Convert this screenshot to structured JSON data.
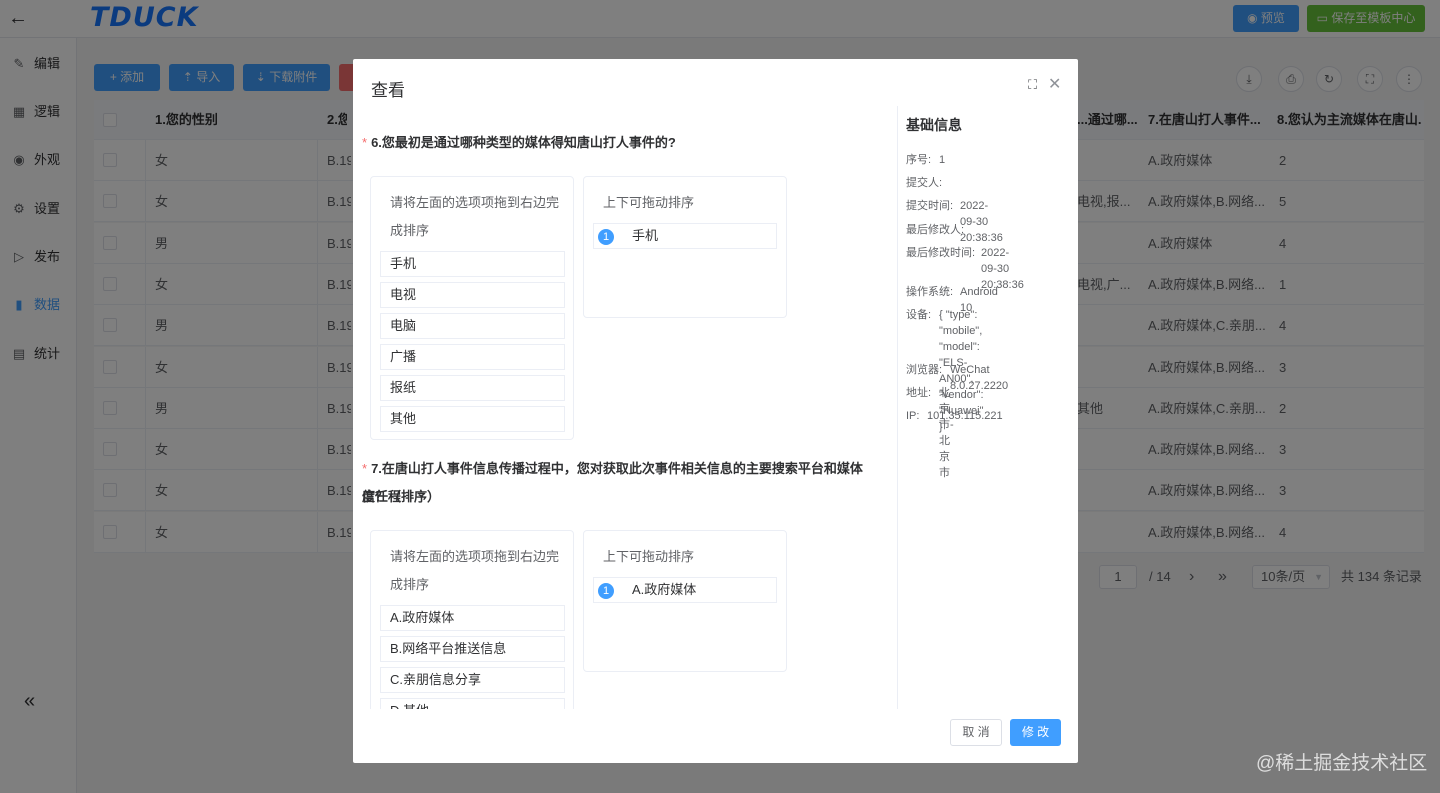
{
  "header": {
    "back_icon": "back-arrow-icon",
    "logo": "TDUCK",
    "preview_label": "预览",
    "save_template_label": "保存至模板中心"
  },
  "sidebar": {
    "items": [
      {
        "label": "编辑",
        "icon": "edit-icon"
      },
      {
        "label": "逻辑",
        "icon": "grid-icon"
      },
      {
        "label": "外观",
        "icon": "eye-icon"
      },
      {
        "label": "设置",
        "icon": "gear-icon"
      },
      {
        "label": "发布",
        "icon": "play-icon"
      },
      {
        "label": "数据",
        "icon": "chart-icon",
        "active": true
      },
      {
        "label": "统计",
        "icon": "stats-icon"
      }
    ],
    "collapse_icon": "double-chevron-left-icon"
  },
  "toolbar": {
    "add_label": "添加",
    "import_label": "导入",
    "download_label": "下载附件"
  },
  "table": {
    "headers": [
      "1.您的性别",
      "2.您...",
      "...通过哪...",
      "7.在唐山打人事件...",
      "8.您认为主流媒体在唐山..."
    ],
    "rows": [
      {
        "c1": "女",
        "c2": "B.19",
        "c3": "",
        "c4": "A.政府媒体",
        "c5": "2"
      },
      {
        "c1": "女",
        "c2": "B.19",
        "c3": "电视,报...",
        "c4": "A.政府媒体,B.网络...",
        "c5": "5"
      },
      {
        "c1": "男",
        "c2": "B.19",
        "c3": "",
        "c4": "A.政府媒体",
        "c5": "4"
      },
      {
        "c1": "女",
        "c2": "B.19",
        "c3": "电视,广...",
        "c4": "A.政府媒体,B.网络...",
        "c5": "1"
      },
      {
        "c1": "男",
        "c2": "B.19",
        "c3": "",
        "c4": "A.政府媒体,C.亲朋...",
        "c5": "4"
      },
      {
        "c1": "女",
        "c2": "B.19",
        "c3": "",
        "c4": "A.政府媒体,B.网络...",
        "c5": "3"
      },
      {
        "c1": "男",
        "c2": "B.19",
        "c3": "其他",
        "c4": "A.政府媒体,C.亲朋...",
        "c5": "2"
      },
      {
        "c1": "女",
        "c2": "B.19",
        "c3": "",
        "c4": "A.政府媒体,B.网络...",
        "c5": "3"
      },
      {
        "c1": "女",
        "c2": "B.19",
        "c3": "",
        "c4": "A.政府媒体,B.网络...",
        "c5": "3"
      },
      {
        "c1": "女",
        "c2": "B.19",
        "c3": "",
        "c4": "A.政府媒体,B.网络...",
        "c5": "4"
      }
    ]
  },
  "pagination": {
    "current_page": "1",
    "total_pages": "/ 14",
    "page_size": "10条/页",
    "total": "共 134 条记录"
  },
  "dialog": {
    "title": "查看",
    "q6": {
      "required": "*",
      "title": "6.您最初是通过哪种类型的媒体得知唐山打人事件的?",
      "left_hint_1": "请将左面的选项项拖到右边完",
      "left_hint_2": "成排序",
      "options": [
        "手机",
        "电视",
        "电脑",
        "广播",
        "报纸",
        "其他"
      ],
      "right_hint": "上下可拖动排序",
      "sorted": [
        {
          "num": "1",
          "text": "手机"
        }
      ]
    },
    "q7": {
      "required": "*",
      "title_1": "7.在唐山打人事件信息传播过程中，您对获取此次事件相关信息的主要搜索平台和媒体信任程",
      "title_2": "度？（排序）",
      "left_hint_1": "请将左面的选项项拖到右边完",
      "left_hint_2": "成排序",
      "options": [
        "A.政府媒体",
        "B.网络平台推送信息",
        "C.亲朋信息分享",
        "D.其他"
      ],
      "right_hint": "上下可拖动排序",
      "sorted": [
        {
          "num": "1",
          "text": "A.政府媒体"
        }
      ]
    },
    "info": {
      "title": "基础信息",
      "serial_k": "序号:",
      "serial_v": "1",
      "submitter_k": "提交人:",
      "submitter_v": "",
      "submit_time_k": "提交时间:",
      "submit_time_v": "2022-09-30 20:38:36",
      "last_modifier_k": "最后修改人:",
      "last_modifier_v": "",
      "last_modify_time_k": "最后修改时间:",
      "last_modify_time_v": "2022-09-30\n20:38:36",
      "os_k": "操作系统:",
      "os_v": "Android 10",
      "device_k": "设备:",
      "device_v": "{ \"type\": \"mobile\",\n\"model\": \"ELS-AN00\",\n\"vendor\": \"Huawei\" }",
      "browser_k": "浏览器:",
      "browser_v": "WeChat 8.0.27.2220",
      "address_k": "地址:",
      "address_v": "北京市-北京市",
      "ip_k": "IP:",
      "ip_v": "101.35.115.221"
    },
    "cancel_label": "取 消",
    "modify_label": "修 改"
  },
  "watermark": "@稀土掘金技术社区"
}
